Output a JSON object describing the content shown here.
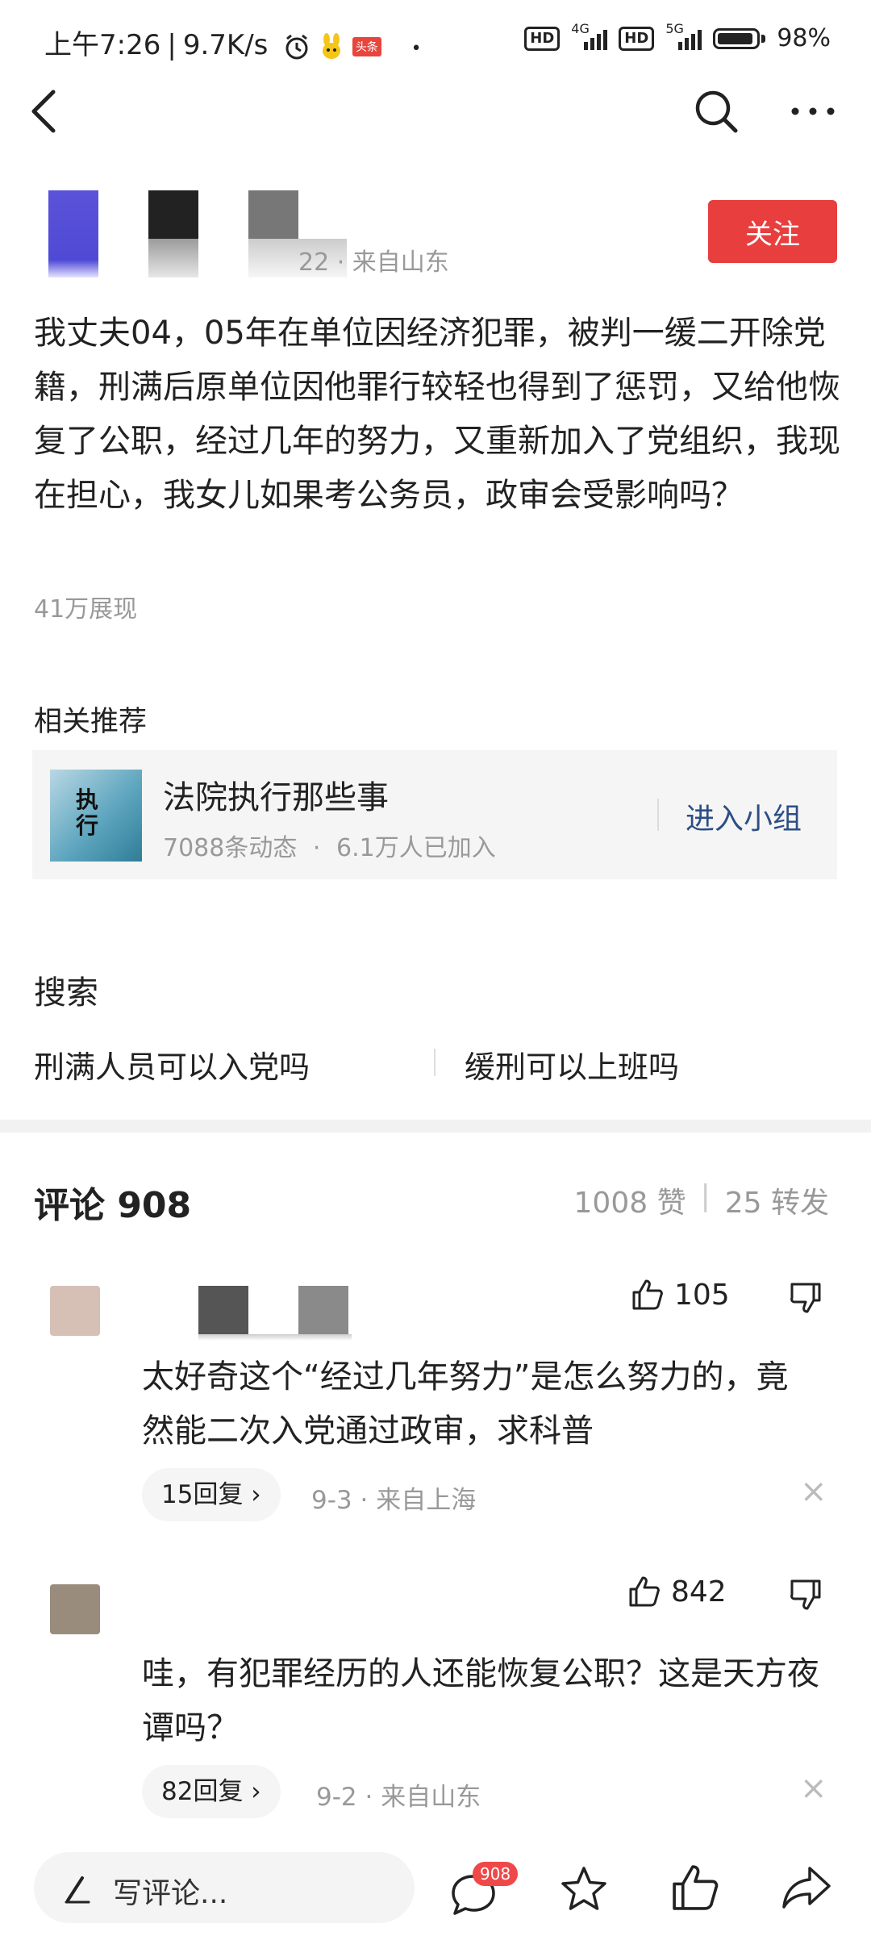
{
  "status_bar": {
    "time": "上午7:26",
    "net_speed": "9.7K/s",
    "toutiao_badge": "头条",
    "net_4g": "4G",
    "net_5g": "5G",
    "hd": "HD",
    "battery": "98%"
  },
  "author": {
    "meta": "22 · 来自山东",
    "follow_label": "关注"
  },
  "question": {
    "text": "我丈夫04，05年在单位因经济犯罪，被判一缓二开除党籍，刑满后原单位因他罪行较轻也得到了惩罚，又给他恢复了公职，经过几年的努力，又重新加入了党组织，我现在担心，我女儿如果考公务员，政审会受影响吗？",
    "views": "41万展现"
  },
  "related": {
    "title": "相关推荐",
    "group": {
      "thumb_text": "执行",
      "name": "法院执行那些事",
      "posts": "7088条动态",
      "dot": "·",
      "members": "6.1万人已加入",
      "join_label": "进入小组"
    }
  },
  "search": {
    "title": "搜索",
    "items": [
      "刑满人员可以入党吗",
      "缓刑可以上班吗"
    ]
  },
  "comments": {
    "title": "评论 908",
    "likes": "1008 赞",
    "sep": "|",
    "shares": "25 转发",
    "items": [
      {
        "likes": "105",
        "text": "太好奇这个“经过几年努力”是怎么努力的，竟然能二次入党通过政审，求科普",
        "replies": "15回复",
        "meta": "9-3 · 来自上海"
      },
      {
        "likes": "842",
        "text": "哇，有犯罪经历的人还能恢复公职？这是天方夜谭吗？",
        "replies": "82回复",
        "meta": "9-2 · 来自山东"
      }
    ]
  },
  "bottom_bar": {
    "write_placeholder": "写评论...",
    "comment_count": "908"
  },
  "colors": {
    "follow": "#e93e3e",
    "join_link": "#2d4e85",
    "badge": "#f04848"
  }
}
